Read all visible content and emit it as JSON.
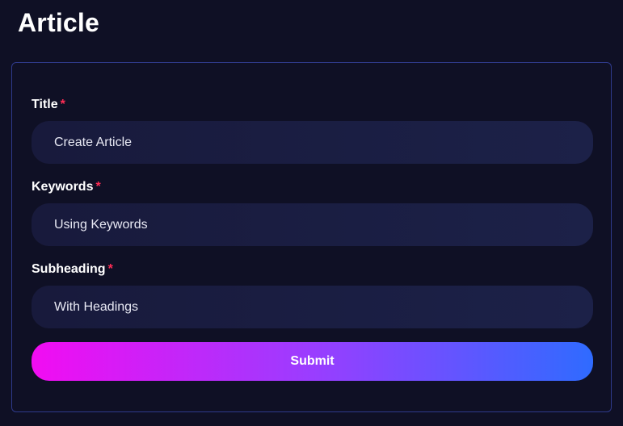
{
  "page": {
    "title": "Article"
  },
  "form": {
    "fields": [
      {
        "label": "Title",
        "required_mark": "*",
        "value": "Create Article"
      },
      {
        "label": "Keywords",
        "required_mark": "*",
        "value": "Using Keywords"
      },
      {
        "label": "Subheading",
        "required_mark": "*",
        "value": "With Headings"
      }
    ],
    "submit_label": "Submit"
  },
  "colors": {
    "background": "#0f1025",
    "card_border": "#2f3a8c",
    "required": "#ff2d55",
    "gradient_start": "#f20cf2",
    "gradient_end": "#2f6bff"
  }
}
